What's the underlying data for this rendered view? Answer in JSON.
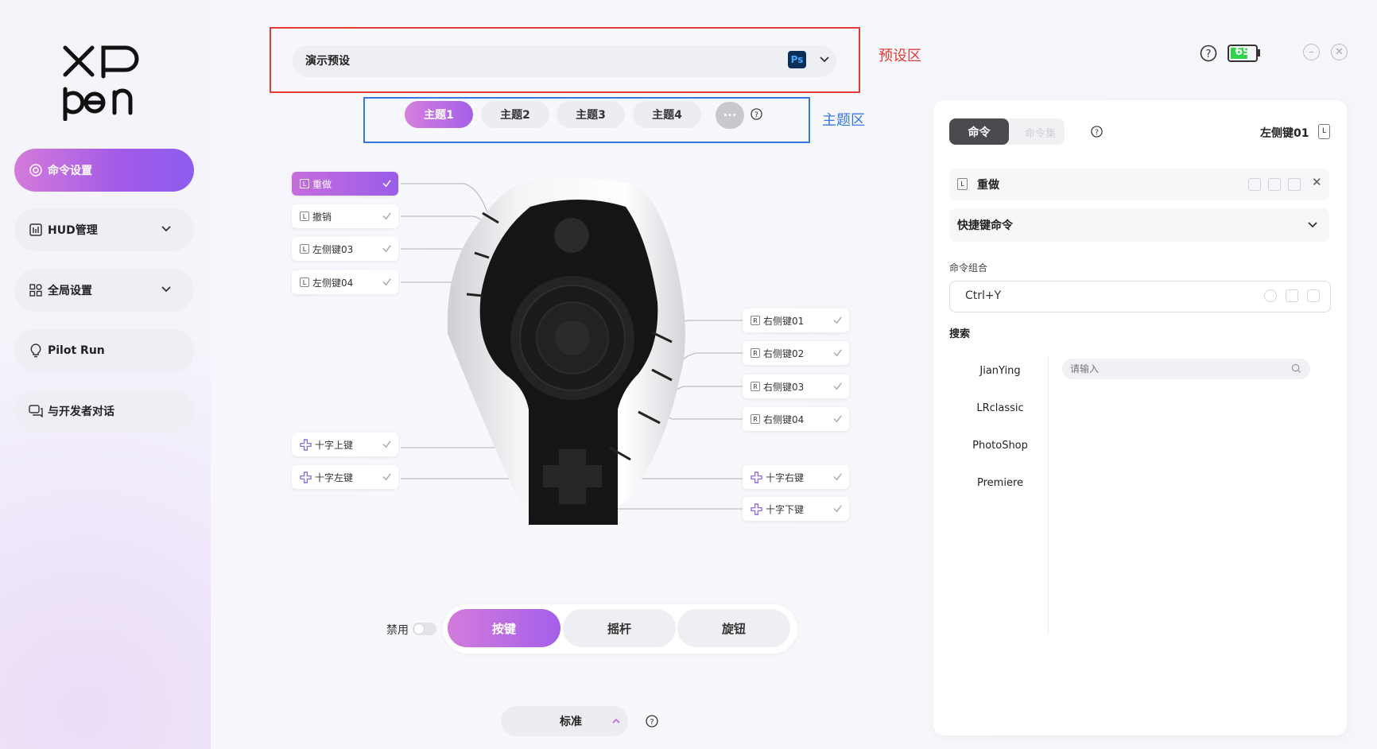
{
  "sidebar": {
    "items": [
      {
        "label": "命令设置",
        "active": true,
        "icon": "target-icon"
      },
      {
        "label": "HUD管理",
        "active": false,
        "icon": "bar-chart-icon",
        "expandable": true
      },
      {
        "label": "全局设置",
        "active": false,
        "icon": "grid-icon",
        "expandable": true
      },
      {
        "label": "Pilot Run",
        "active": false,
        "icon": "bulb-icon"
      },
      {
        "label": "与开发者对话",
        "active": false,
        "icon": "chat-icon"
      }
    ]
  },
  "preset": {
    "name": "演示预设",
    "app_badge": "Ps",
    "annotation": "预设区"
  },
  "themes": {
    "tabs": [
      "主题1",
      "主题2",
      "主题3",
      "主题4"
    ],
    "active_index": 0,
    "more": "···",
    "annotation": "主题区"
  },
  "status": {
    "battery": "69",
    "battery_level": 0.69
  },
  "keys": {
    "left": [
      "重做",
      "撤销",
      "左侧键03",
      "左侧键04"
    ],
    "right": [
      "右侧键01",
      "右侧键02",
      "右侧键03",
      "右侧键04"
    ],
    "dpad_left": [
      "十字上键",
      "十字左键"
    ],
    "dpad_right": [
      "十字右键",
      "十字下键"
    ],
    "selected": "重做",
    "key_badge_left": "L",
    "key_badge_right": "R"
  },
  "modes": {
    "disable_label": "禁用",
    "items": [
      "按键",
      "摇杆",
      "旋钮"
    ],
    "active_index": 0
  },
  "profile": {
    "label": "标准"
  },
  "panel": {
    "tabs": [
      "命令",
      "命令集"
    ],
    "active_tab": 0,
    "key_title": "左侧键01",
    "key_badge": "L",
    "command_name": "重做",
    "command_type": "快捷键命令",
    "combo_label": "命令组合",
    "combo_value": "Ctrl+Y",
    "search_label": "搜索",
    "search_placeholder": "请输入",
    "apps": [
      "JianYing",
      "LRclassic",
      "PhotoShop",
      "Premiere"
    ]
  },
  "colors": {
    "accent": "#a15ae8",
    "preset_frame": "#e53935",
    "theme_frame": "#3877e0",
    "battery": "#2fd44b"
  }
}
